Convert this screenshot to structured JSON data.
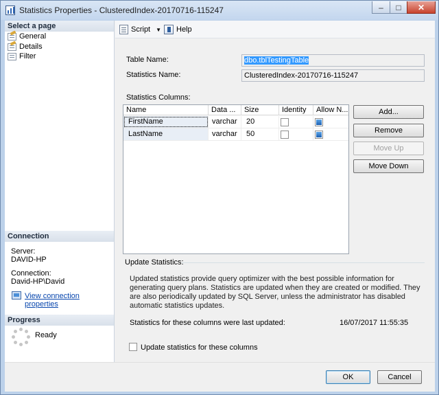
{
  "window": {
    "title": "Statistics Properties - ClusteredIndex-20170716-115247",
    "controls": {
      "minimize": "–",
      "maximize": "□",
      "close": "✕"
    }
  },
  "left_pane": {
    "select_page_header": "Select a page",
    "pages": [
      "General",
      "Details",
      "Filter"
    ],
    "connection_header": "Connection",
    "server_label": "Server:",
    "server_value": "DAVID-HP",
    "connection_label": "Connection:",
    "connection_value": "David-HP\\David",
    "view_connection_link": "View connection properties",
    "progress_header": "Progress",
    "progress_status": "Ready"
  },
  "toolbar": {
    "script_label": "Script",
    "help_label": "Help"
  },
  "form": {
    "table_name_label": "Table Name:",
    "table_name_value": "dbo.tblTestingTable",
    "statistics_name_label": "Statistics Name:",
    "statistics_name_value": "ClusteredIndex-20170716-115247",
    "statistics_columns_label": "Statistics Columns:"
  },
  "columns_grid": {
    "headers": [
      "Name",
      "Data ...",
      "Size",
      "Identity",
      "Allow N..."
    ],
    "rows": [
      {
        "name": "FirstName",
        "data_type": "varchar",
        "size": "20",
        "identity": false,
        "allow_nulls": true
      },
      {
        "name": "LastName",
        "data_type": "varchar",
        "size": "50",
        "identity": false,
        "allow_nulls": true
      }
    ]
  },
  "side_buttons": {
    "add": "Add...",
    "remove": "Remove",
    "move_up": "Move Up",
    "move_down": "Move Down"
  },
  "update_statistics": {
    "header": "Update Statistics:",
    "description": "Updated statistics provide query optimizer with the best possible information for generating query plans. Statistics are updated when they are created or modified. They are also periodically updated by SQL Server, unless the administrator has disabled automatic statistics updates.",
    "last_updated_label": "Statistics for these columns were last updated:",
    "last_updated_value": "16/07/2017 11:55:35",
    "checkbox_label": "Update statistics for these columns",
    "checkbox_checked": false
  },
  "footer": {
    "ok": "OK",
    "cancel": "Cancel"
  },
  "colors": {
    "title_bar": "#c3d6ee",
    "selection": "#3399ff",
    "link": "#0645ad"
  }
}
